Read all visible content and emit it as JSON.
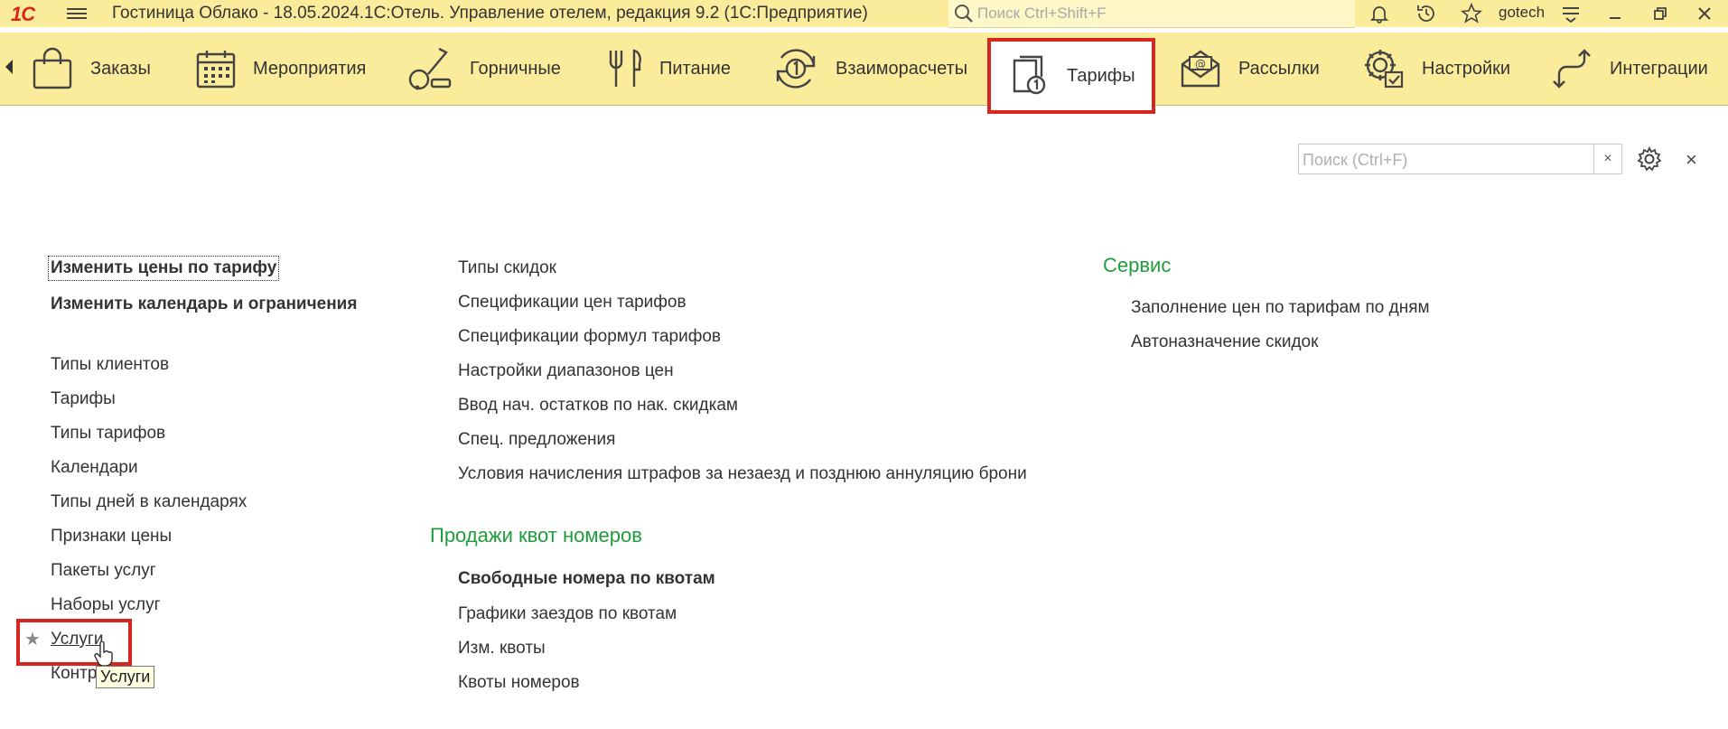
{
  "titlebar": {
    "logo": "1С",
    "title": "Гостиница Облако - 18.05.2024.1С:Отель. Управление отелем, редакция 9.2  (1С:Предприятие)",
    "search_placeholder": "Поиск Ctrl+Shift+F",
    "user": "gotech"
  },
  "sections": [
    {
      "label": "Заказы",
      "icon": "shopping-bag-icon"
    },
    {
      "label": "Мероприятия",
      "icon": "calendar-icon"
    },
    {
      "label": "Горничные",
      "icon": "vacuum-cleaner-icon"
    },
    {
      "label": "Питание",
      "icon": "fork-knife-icon"
    },
    {
      "label": "Взаиморасчеты",
      "icon": "settlement-cycle-icon"
    },
    {
      "label": "Тарифы",
      "icon": "tariff-book-icon",
      "active": true
    },
    {
      "label": "Рассылки",
      "icon": "email-envelope-icon"
    },
    {
      "label": "Настройки",
      "icon": "settings-gear-icon"
    },
    {
      "label": "Интеграции",
      "icon": "integration-arrows-icon"
    }
  ],
  "panel": {
    "search_placeholder": "Поиск (Ctrl+F)",
    "clear_label": "×",
    "close_label": "×"
  },
  "col1": [
    "Изменить цены по тарифу",
    "Изменить календарь и ограничения",
    "Типы клиентов",
    "Тарифы",
    "Типы тарифов",
    "Календари",
    "Типы дней в календарях",
    "Признаки цены",
    "Пакеты услуг",
    "Наборы услуг",
    "Услуги",
    "Контр"
  ],
  "col2": [
    "Типы скидок",
    "Спецификации цен тарифов",
    "Спецификации формул тарифов",
    "Настройки диапазонов цен",
    "Ввод нач. остатков по нак. скидкам",
    "Спец. предложения",
    "Условия начисления штрафов за незаезд и позднюю аннуляцию брони"
  ],
  "group_quotas": {
    "title": "Продажи квот номеров",
    "items": [
      "Свободные номера по квотам",
      "Графики заездов по квотам",
      "Изм. квоты",
      "Квоты номеров"
    ]
  },
  "group_service": {
    "title": "Сервис",
    "items": [
      "Заполнение цен по тарифам по дням",
      "Автоназначение скидок"
    ]
  },
  "tooltip": "Услуги",
  "colors": {
    "header_bg": "#fbec9b",
    "highlight_red": "#d7261e",
    "group_green": "#1e9d3a"
  }
}
